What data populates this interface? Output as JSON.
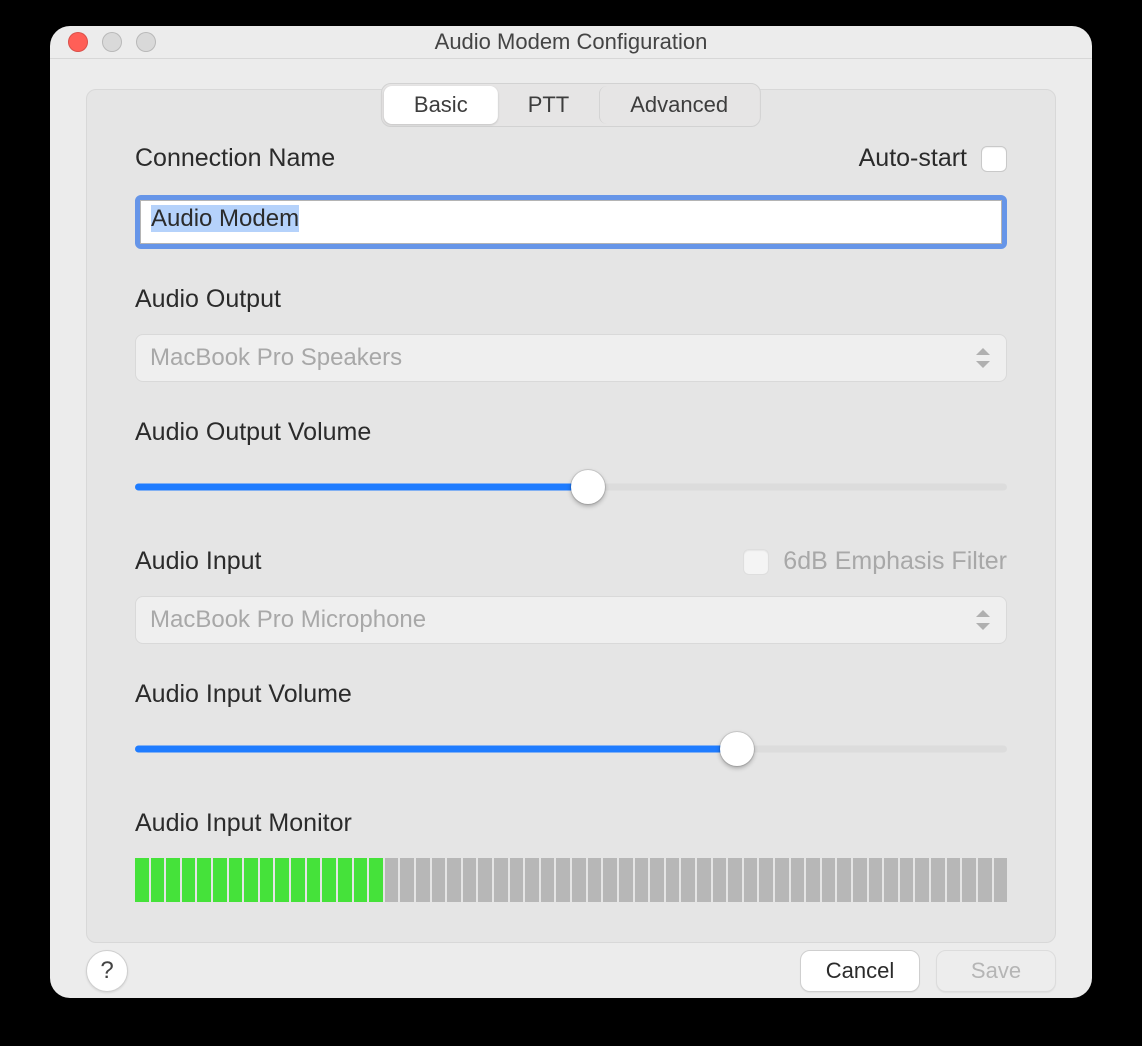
{
  "window": {
    "title": "Audio Modem Configuration"
  },
  "tabs": {
    "items": [
      "Basic",
      "PTT",
      "Advanced"
    ],
    "active_index": 0
  },
  "form": {
    "connection_name_label": "Connection Name",
    "connection_name_value": "Audio Modem",
    "autostart_label": "Auto-start",
    "autostart_checked": false,
    "audio_output_label": "Audio Output",
    "audio_output_value": "MacBook Pro Speakers",
    "audio_output_volume_label": "Audio Output Volume",
    "audio_output_volume_percent": 52,
    "audio_input_label": "Audio Input",
    "emphasis_filter_label": "6dB Emphasis Filter",
    "emphasis_filter_checked": false,
    "emphasis_filter_enabled": false,
    "audio_input_value": "MacBook Pro Microphone",
    "audio_input_volume_label": "Audio Input Volume",
    "audio_input_volume_percent": 69,
    "audio_input_monitor_label": "Audio Input Monitor",
    "monitor_total_segments": 56,
    "monitor_lit_segments": 16
  },
  "footer": {
    "help_symbol": "?",
    "cancel_label": "Cancel",
    "save_label": "Save",
    "save_enabled": false
  }
}
